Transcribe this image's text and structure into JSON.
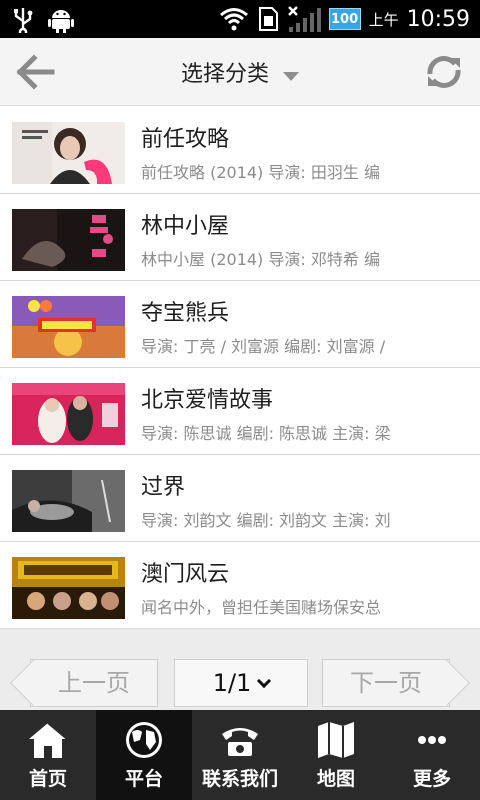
{
  "status_bar": {
    "ampm": "上午",
    "time": "10:59",
    "battery": "100"
  },
  "header": {
    "title": "选择分类"
  },
  "items": [
    {
      "title": "前任攻略",
      "subtitle": "前任攻略 (2014) 导演: 田羽生 编"
    },
    {
      "title": "林中小屋",
      "subtitle": "林中小屋 (2014) 导演: 邓特希 编"
    },
    {
      "title": "夺宝熊兵",
      "subtitle": "导演: 丁亮 / 刘富源 编剧: 刘富源 /"
    },
    {
      "title": "北京爱情故事",
      "subtitle": "导演: 陈思诚 编剧: 陈思诚 主演: 梁"
    },
    {
      "title": "过界",
      "subtitle": "导演: 刘韵文 编剧: 刘韵文 主演: 刘"
    },
    {
      "title": "澳门风云",
      "subtitle": "闻名中外，曾担任美国赌场保安总"
    }
  ],
  "pager": {
    "prev_label": "上一页",
    "page_value": "1/1",
    "next_label": "下一页"
  },
  "nav": [
    {
      "label": "首页",
      "icon": "home-icon"
    },
    {
      "label": "平台",
      "icon": "globe-icon"
    },
    {
      "label": "联系我们",
      "icon": "phone-icon"
    },
    {
      "label": "地图",
      "icon": "map-icon"
    },
    {
      "label": "更多",
      "icon": "more-icon"
    }
  ],
  "colors": {
    "statusbar_bg": "#000000",
    "header_bg": "#f4f4f4",
    "nav_bg": "#2a2a2a",
    "nav_active_bg": "#111111",
    "subtitle_text": "#8c8c8c",
    "battery_bg": "#35a7e8"
  }
}
